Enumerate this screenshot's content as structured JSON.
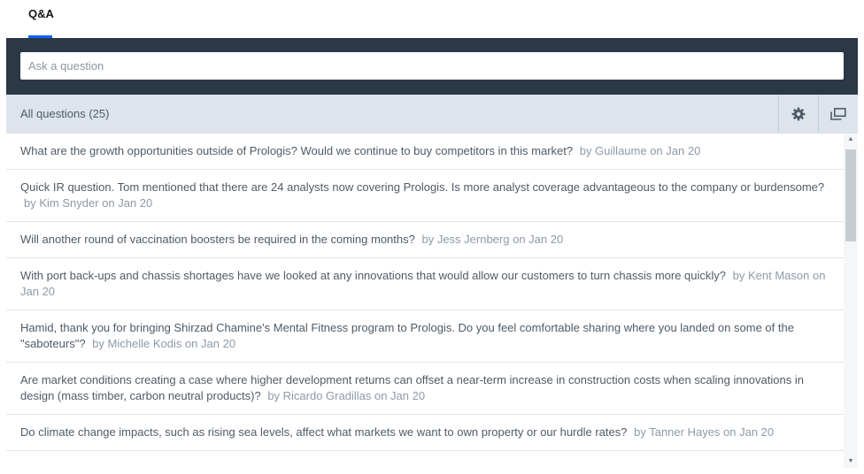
{
  "tabs": [
    {
      "label": "Q&A",
      "active": true
    }
  ],
  "ask": {
    "placeholder": "Ask a question",
    "value": ""
  },
  "filter": {
    "label": "All questions (25)",
    "settings_icon": "gear-icon",
    "popout_icon": "popout-window-icon"
  },
  "colors": {
    "accent": "#0f62fe",
    "header_dark": "#2b3846",
    "filter_bar": "#dde4ec",
    "meta_text": "#8d9aa8"
  },
  "questions": [
    {
      "text": "What are the growth opportunities outside of Prologis? Would we continue to buy competitors in this market?",
      "meta": "by Guillaume on Jan 20"
    },
    {
      "text": "Quick IR question. Tom mentioned that there are 24 analysts now covering Prologis. Is more analyst coverage advantageous to the company or burdensome?",
      "meta": "by Kim Snyder on Jan 20"
    },
    {
      "text": "Will another round of vaccination boosters be required in the coming months?",
      "meta": "by Jess Jernberg on Jan 20"
    },
    {
      "text": "With port back-ups and chassis shortages have we looked at any innovations that would allow our customers to turn chassis more quickly?",
      "meta": "by Kent Mason on Jan 20"
    },
    {
      "text": "Hamid, thank you for bringing Shirzad Chamine's Mental Fitness program to Prologis. Do you feel comfortable sharing where you landed on some of the \"saboteurs\"?",
      "meta": "by Michelle Kodis on Jan 20"
    },
    {
      "text": "Are market conditions creating a case where higher development returns can offset a near-term increase in construction costs when scaling innovations in design (mass timber, carbon neutral products)?",
      "meta": "by Ricardo Gradillas on Jan 20"
    },
    {
      "text": "Do climate change impacts, such as rising sea levels, affect what markets we want to own property or our hurdle rates?",
      "meta": "by Tanner Hayes on Jan 20"
    }
  ]
}
